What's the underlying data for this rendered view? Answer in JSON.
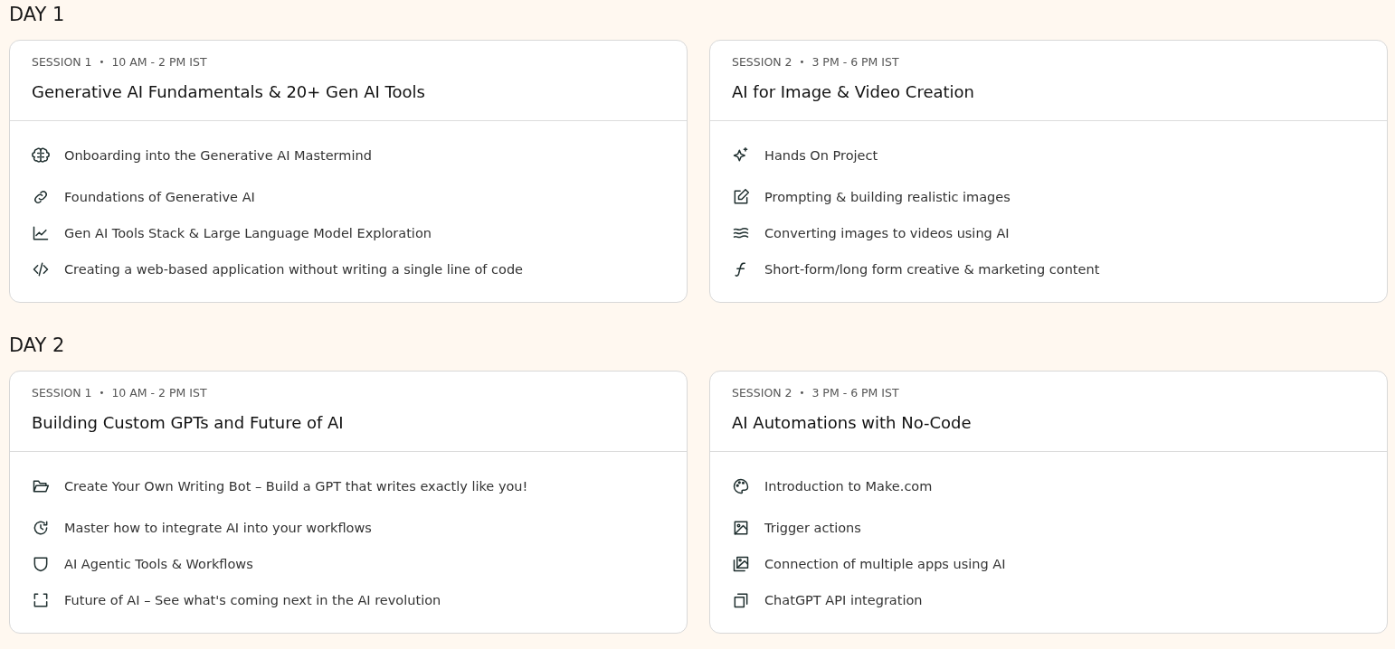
{
  "days": [
    {
      "title": "DAY 1",
      "sessions": [
        {
          "label": "SESSION 1",
          "separator": "•",
          "time": "10 AM - 2 PM IST",
          "title": "Generative AI Fundamentals & 20+ Gen AI Tools",
          "topics": [
            {
              "kind": "brain",
              "text": "Onboarding into the Generative AI Mastermind"
            },
            {
              "kind": "link",
              "text": "Foundations of Generative AI"
            },
            {
              "kind": "chart",
              "text": "Gen AI Tools Stack & Large Language Model Exploration"
            },
            {
              "kind": "code",
              "text": "Creating a web-based application without writing a single line of code"
            }
          ]
        },
        {
          "label": "SESSION 2",
          "separator": "•",
          "time": "3 PM - 6 PM IST",
          "title": "AI for Image & Video Creation",
          "topics": [
            {
              "kind": "sparkle",
              "text": "Hands On Project"
            },
            {
              "kind": "edit",
              "text": "Prompting & building realistic images"
            },
            {
              "kind": "waves",
              "text": "Converting images to videos using AI"
            },
            {
              "kind": "function",
              "text": "Short-form/long form creative & marketing content"
            }
          ]
        }
      ]
    },
    {
      "title": "DAY 2",
      "sessions": [
        {
          "label": "SESSION 1",
          "separator": "•",
          "time": "10 AM - 2 PM IST",
          "title": "Building Custom GPTs and Future of AI",
          "topics": [
            {
              "kind": "folder",
              "text": "Create Your Own Writing Bot – Build a GPT that writes exactly like you!"
            },
            {
              "kind": "refresh",
              "text": "Master how to integrate AI into your workflows"
            },
            {
              "kind": "shield",
              "text": "AI Agentic Tools & Workflows"
            },
            {
              "kind": "frame",
              "text": "Future of AI – See what's coming next in the AI revolution"
            }
          ]
        },
        {
          "label": "SESSION 2",
          "separator": "•",
          "time": "3 PM - 6 PM IST",
          "title": "AI Automations with No-Code",
          "topics": [
            {
              "kind": "palette",
              "text": "Introduction to Make.com"
            },
            {
              "kind": "image",
              "text": "Trigger actions"
            },
            {
              "kind": "images",
              "text": "Connection of multiple apps using AI"
            },
            {
              "kind": "copy",
              "text": "ChatGPT API integration"
            }
          ]
        }
      ]
    }
  ]
}
